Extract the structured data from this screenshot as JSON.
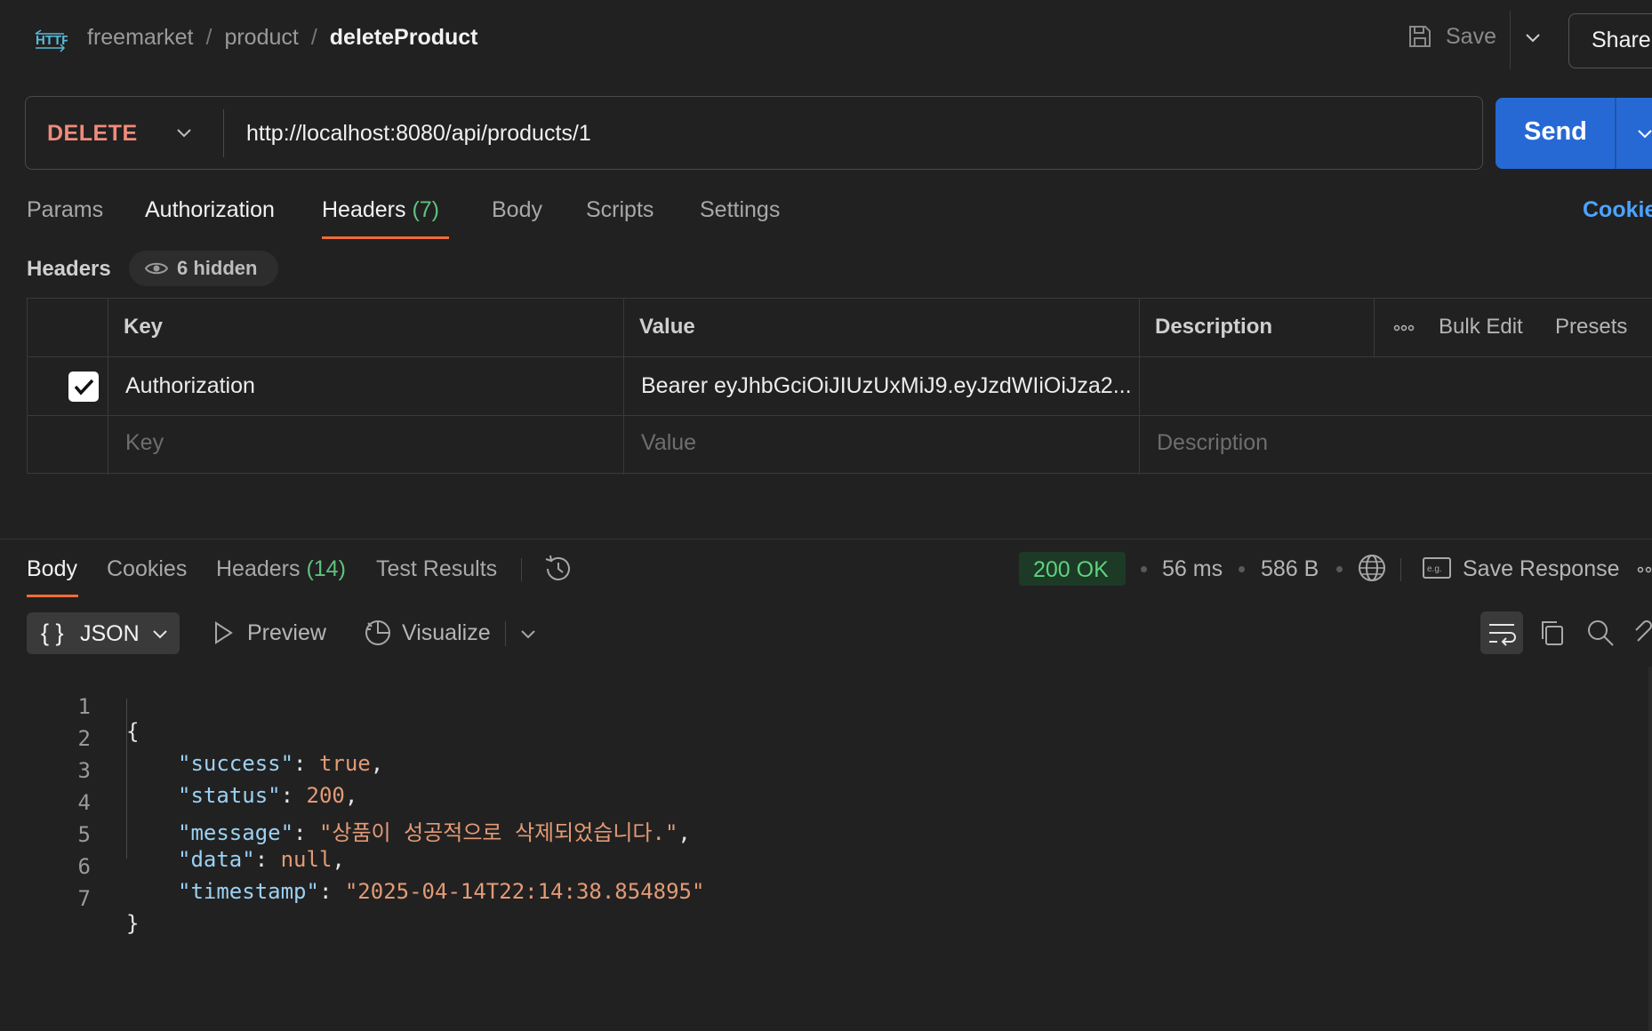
{
  "topbar": {
    "breadcrumb": [
      "freemarket",
      "product",
      "deleteProduct"
    ],
    "separator": "/",
    "save_label": "Save",
    "share_label": "Share"
  },
  "request": {
    "method": "DELETE",
    "url": "http://localhost:8080/api/products/1",
    "send_label": "Send",
    "method_color": "#f08b7b"
  },
  "req_tabs": [
    {
      "label": "Params"
    },
    {
      "label": "Authorization"
    },
    {
      "label": "Headers",
      "count": "(7)",
      "active": true
    },
    {
      "label": "Body"
    },
    {
      "label": "Scripts"
    },
    {
      "label": "Settings"
    }
  ],
  "cookies_label": "Cookie",
  "headers_section": {
    "title": "Headers",
    "hidden_label": "6 hidden",
    "columns": [
      "Key",
      "Value",
      "Description"
    ],
    "bulk_edit_label": "Bulk Edit",
    "presets_label": "Presets",
    "rows": [
      {
        "checked": true,
        "key": "Authorization",
        "value": "Bearer eyJhbGciOiJIUzUxMiJ9.eyJzdWIiOiJza2...",
        "description": ""
      }
    ],
    "placeholder": {
      "key": "Key",
      "value": "Value",
      "description": "Description"
    }
  },
  "response": {
    "tabs": [
      {
        "label": "Body",
        "active": true
      },
      {
        "label": "Cookies"
      },
      {
        "label": "Headers",
        "count": "(14)"
      },
      {
        "label": "Test Results"
      }
    ],
    "status": "200 OK",
    "time": "56 ms",
    "size": "586 B",
    "save_response_label": "Save Response",
    "format": "JSON",
    "preview_label": "Preview",
    "visualize_label": "Visualize",
    "status_color": "#5fd17e"
  },
  "code": {
    "line_numbers": [
      "1",
      "2",
      "3",
      "4",
      "5",
      "6",
      "7"
    ],
    "open_brace": "{",
    "close_brace": "}",
    "fields": [
      {
        "key": "\"success\"",
        "value": "true",
        "trail": ","
      },
      {
        "key": "\"status\"",
        "value": "200",
        "trail": ","
      },
      {
        "key": "\"message\"",
        "value": "\"상품이 성공적으로 삭제되었습니다.\"",
        "trail": ","
      },
      {
        "key": "\"data\"",
        "value": "null",
        "trail": ","
      },
      {
        "key": "\"timestamp\"",
        "value": "\"2025-04-14T22:14:38.854895\"",
        "trail": ""
      }
    ]
  },
  "icons": [
    "http-icon",
    "save-icon",
    "chevron-down-icon",
    "eye-icon",
    "ellipsis-icon",
    "history-icon",
    "globe-icon",
    "save-response-icon",
    "braces-icon",
    "play-icon",
    "visualize-icon",
    "wrap-icon",
    "copy-icon",
    "search-icon",
    "link-icon"
  ]
}
